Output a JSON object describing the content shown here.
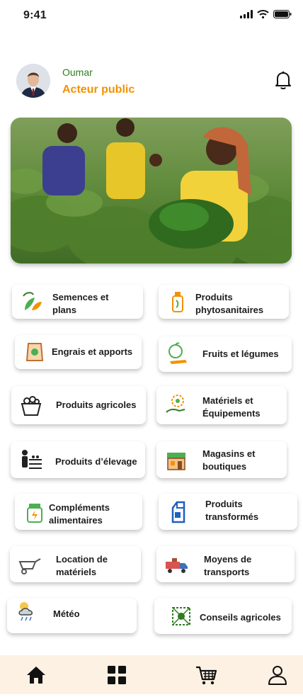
{
  "status": {
    "time": "9:41"
  },
  "profile": {
    "name": "Oumar",
    "role": "Acteur public"
  },
  "colors": {
    "accent": "#f39200",
    "green": "#2f7d1f",
    "nav_bg": "#fcf1e3"
  },
  "categories": [
    {
      "label": "Semences et\nplans",
      "icon": "seedling-icon"
    },
    {
      "label": "Produits\nphytosanitaires",
      "icon": "spray-bottle-icon"
    },
    {
      "label": "Engrais et apports",
      "icon": "fertilizer-bag-icon"
    },
    {
      "label": "Fruits et légumes",
      "icon": "fruits-vegetables-icon"
    },
    {
      "label": "Produits agricoles",
      "icon": "produce-basket-icon"
    },
    {
      "label": "Matériels et\nÉquipements",
      "icon": "equipment-icon"
    },
    {
      "label": "Produits d’élevage",
      "icon": "livestock-icon"
    },
    {
      "label": "Magasins et\nboutiques",
      "icon": "store-icon"
    },
    {
      "label": "Compléments\nalimentaires",
      "icon": "supplement-jar-icon"
    },
    {
      "label": "Produits\ntransformés",
      "icon": "milk-carton-icon"
    },
    {
      "label": "Location de\nmatériels",
      "icon": "wheelbarrow-icon"
    },
    {
      "label": "Moyens de\ntransports",
      "icon": "truck-icon"
    },
    {
      "label": "Météo",
      "icon": "weather-icon"
    },
    {
      "label": "Conseils agricoles",
      "icon": "advice-icon"
    }
  ],
  "nav": [
    {
      "name": "home",
      "icon": "home-icon"
    },
    {
      "name": "categories",
      "icon": "grid-icon"
    },
    {
      "name": "cart",
      "icon": "cart-icon"
    },
    {
      "name": "profile",
      "icon": "user-icon"
    }
  ]
}
